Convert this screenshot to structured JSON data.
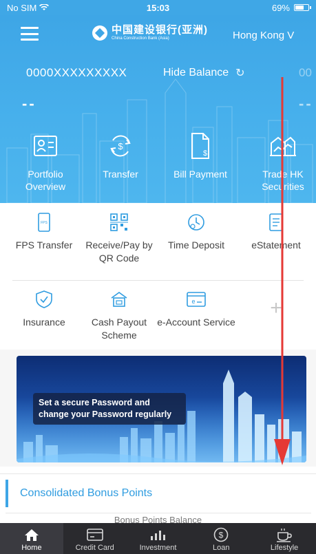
{
  "status_bar": {
    "carrier": "No SIM",
    "time": "15:03",
    "battery": "69%",
    "battery_level": 0.69
  },
  "header": {
    "brand_cn": "中国建设银行(亚洲)",
    "brand_en": "China Construction Bank (Asia)",
    "region": "Hong Kong V"
  },
  "account": {
    "number": "0000XXXXXXXXX",
    "hide_balance": "Hide Balance",
    "next_account_peek": "00",
    "balance_placeholder": "--",
    "balance_placeholder_right": "--"
  },
  "hero_shortcuts": [
    {
      "label": "Portfolio Overview",
      "icon": "portfolio-icon"
    },
    {
      "label": "Transfer",
      "icon": "transfer-icon"
    },
    {
      "label": "Bill Payment",
      "icon": "bill-icon"
    },
    {
      "label": "Trade HK Securities",
      "icon": "securities-icon"
    }
  ],
  "functions": [
    {
      "label": "FPS Transfer",
      "icon": "fps-icon"
    },
    {
      "label": "Receive/Pay by QR Code",
      "icon": "qr-code-icon"
    },
    {
      "label": "Time Deposit",
      "icon": "time-deposit-icon"
    },
    {
      "label": "eStatement",
      "icon": "estatement-icon"
    },
    {
      "label": "Insurance",
      "icon": "insurance-icon"
    },
    {
      "label": "Cash Payout Scheme",
      "icon": "cash-payout-icon"
    },
    {
      "label": "e-Account Service",
      "icon": "e-account-icon"
    },
    {
      "label": "+",
      "icon": "add-icon"
    }
  ],
  "banner": {
    "text": "Set a secure Password and change your Password regularly"
  },
  "bonus": {
    "title": "Consolidated Bonus Points",
    "subtitle": "Bonus Points Balance"
  },
  "tabs": [
    {
      "label": "Home",
      "icon": "home-icon",
      "active": true
    },
    {
      "label": "Credit Card",
      "icon": "credit-card-icon",
      "active": false
    },
    {
      "label": "Investment",
      "icon": "investment-icon",
      "active": false
    },
    {
      "label": "Loan",
      "icon": "loan-icon",
      "active": false
    },
    {
      "label": "Lifestyle",
      "icon": "lifestyle-icon",
      "active": false
    }
  ],
  "colors": {
    "header_blue": "#3ea6e6",
    "accent_blue": "#2f9ce0",
    "tab_bar": "#2a2a2e",
    "annotation_red": "#e53935"
  }
}
